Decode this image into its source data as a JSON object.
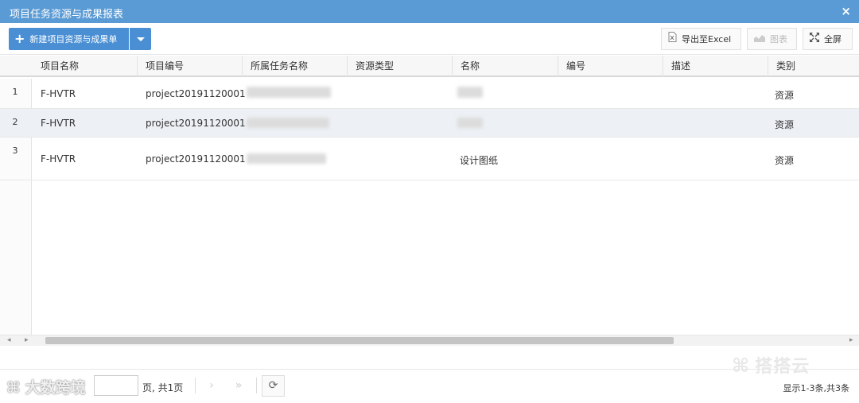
{
  "window": {
    "title": "项目任务资源与成果报表",
    "close_icon": "×"
  },
  "toolbar": {
    "new_label": "新建项目资源与成果单",
    "excel_label": "导出至Excel",
    "chart_label": "图表",
    "fullscreen_label": "全屏"
  },
  "table": {
    "columns": [
      "项目名称",
      "项目编号",
      "所属任务名称",
      "资源类型",
      "名称",
      "编号",
      "描述",
      "类别"
    ],
    "rows": [
      {
        "num": "1",
        "project_name": "F-HVTR",
        "project_code": "project20191120001",
        "task_name": "",
        "resource_type": "",
        "name": "",
        "code": "",
        "description": "",
        "category": "资源"
      },
      {
        "num": "2",
        "project_name": "F-HVTR",
        "project_code": "project20191120001",
        "task_name": "",
        "resource_type": "",
        "name": "",
        "code": "",
        "description": "",
        "category": "资源"
      },
      {
        "num": "3",
        "project_name": "F-HVTR",
        "project_code": "project20191120001",
        "task_name": "",
        "resource_type": "",
        "name": "设计图纸",
        "code": "",
        "description": "",
        "category": "资源"
      }
    ]
  },
  "pager": {
    "page_value": "",
    "page_suffix": "页, 共1页",
    "display_text": "显示1-3条,共3条"
  },
  "watermarks": {
    "right": "搭搭云",
    "left": "大数跨境"
  },
  "colors": {
    "titlebar": "#5b9bd5",
    "primary_button": "#4a8fd4",
    "selected_row": "#edf1f5"
  }
}
